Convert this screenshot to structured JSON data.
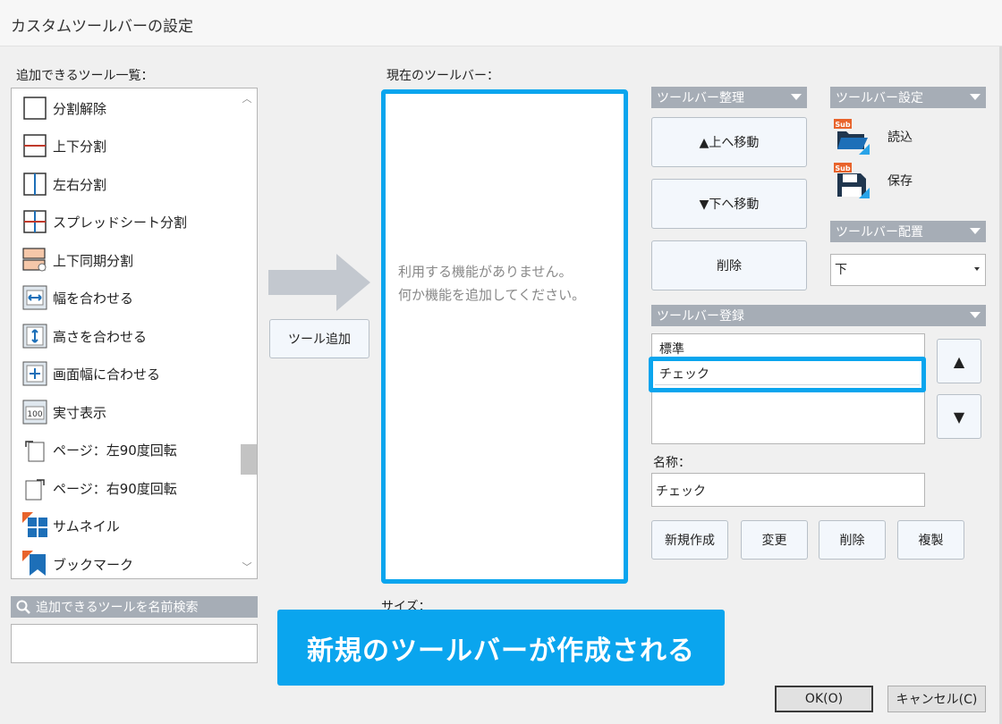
{
  "window": {
    "title": "カスタムツールバーの設定"
  },
  "left_panel": {
    "label": "追加できるツール一覧：",
    "items": [
      {
        "label": "分割解除",
        "icon": "split-off-icon"
      },
      {
        "label": "上下分割",
        "icon": "split-horizontal-icon"
      },
      {
        "label": "左右分割",
        "icon": "split-vertical-icon"
      },
      {
        "label": "スプレッドシート分割",
        "icon": "split-grid-icon"
      },
      {
        "label": "上下同期分割",
        "icon": "split-sync-icon"
      },
      {
        "label": "幅を合わせる",
        "icon": "fit-width-icon"
      },
      {
        "label": "高さを合わせる",
        "icon": "fit-height-icon"
      },
      {
        "label": "画面幅に合わせる",
        "icon": "fit-screen-icon"
      },
      {
        "label": "実寸表示",
        "icon": "actual-size-icon"
      },
      {
        "label": "ページ：左90度回転",
        "icon": "rotate-left-icon"
      },
      {
        "label": "ページ：右90度回転",
        "icon": "rotate-right-icon"
      },
      {
        "label": "サムネイル",
        "icon": "thumbnail-icon"
      },
      {
        "label": "ブックマーク",
        "icon": "bookmark-icon"
      }
    ],
    "search_label": "追加できるツールを名前検索",
    "search_value": ""
  },
  "add_button": {
    "label": "ツール追加"
  },
  "current_toolbar": {
    "label": "現在のツールバー：",
    "empty_line1": "利用する機能がありません。",
    "empty_line2": "何か機能を追加してください。",
    "size_label": "サイズ："
  },
  "organize": {
    "header": "ツールバー整理",
    "move_up": "▲上へ移動",
    "move_down": "▼下へ移動",
    "delete": "削除"
  },
  "settings": {
    "header": "ツールバー設定",
    "load": "読込",
    "save": "保存",
    "badge": "Sub"
  },
  "placement": {
    "header": "ツールバー配置",
    "value": "下"
  },
  "registration": {
    "header": "ツールバー登録",
    "items": [
      "標準",
      "チェック"
    ],
    "up": "▲",
    "down": "▼",
    "name_label": "名称：",
    "name_value": "チェック",
    "new": "新規作成",
    "change": "変更",
    "delete": "削除",
    "duplicate": "複製"
  },
  "banner": {
    "text": "新規のツールバーが作成される"
  },
  "dialog": {
    "ok": "OK(O)",
    "cancel": "キャンセル(C)"
  },
  "colors": {
    "accent": "#0aa5ee",
    "header": "#a6adb6",
    "line": "#c0392b"
  }
}
